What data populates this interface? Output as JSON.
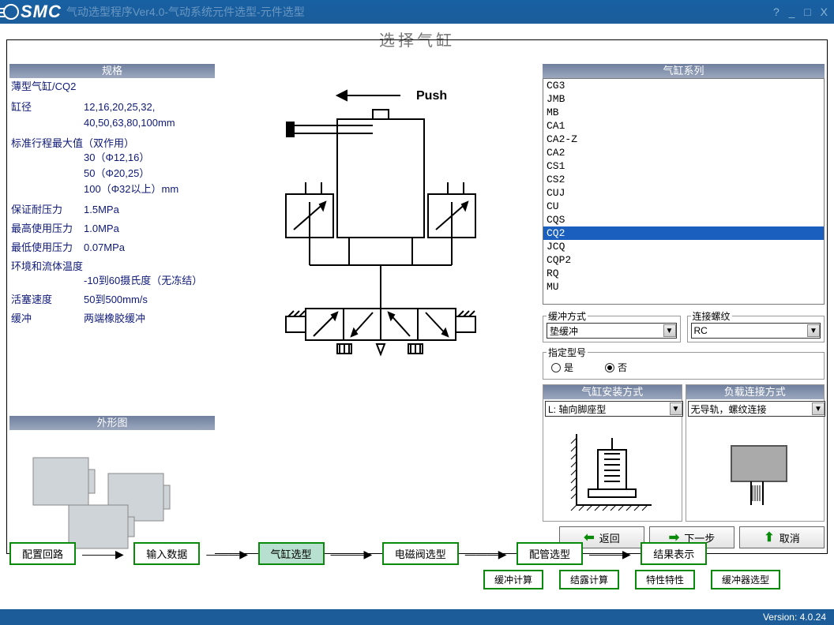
{
  "titlebar": {
    "logo": "SMC",
    "title": "气动选型程序Ver4.0-气动系统元件选型-元件选型",
    "controls": "? _ □ X"
  },
  "page_title": "选择气缸",
  "spec_panel": {
    "title": "规格",
    "model": "薄型气缸/CQ2",
    "rows": {
      "bore_label": "缸径",
      "bore_val1": "12,16,20,25,32,",
      "bore_val2": "40,50,63,80,100mm",
      "stroke_label": "标准行程最大值（双作用）",
      "stroke_val1": "30（Φ12,16）",
      "stroke_val2": "50（Φ20,25）",
      "stroke_val3": "100（Φ32以上）mm",
      "proof_label": "保证耐压力",
      "proof_val": "1.5MPa",
      "max_label": "最高使用压力",
      "max_val": "1.0MPa",
      "min_label": "最低使用压力",
      "min_val": "0.07MPa",
      "temp_label": "环境和流体温度",
      "temp_val": "-10到60摄氏度（无冻结）",
      "speed_label": "活塞速度",
      "speed_val": "50到500mm/s",
      "cushion_label": "缓冲",
      "cushion_val": "两端橡胶缓冲"
    }
  },
  "shape_panel": {
    "title": "外形图"
  },
  "series_panel": {
    "title": "气缸系列",
    "items": [
      "CG3",
      "JMB",
      "MB",
      "CA1",
      "CA2-Z",
      "CA2",
      "CS1",
      "CS2",
      "CUJ",
      "CU",
      "CQS",
      "CQ2",
      "JCQ",
      "CQP2",
      "RQ",
      "MU"
    ],
    "selected": "CQ2"
  },
  "opts": {
    "cushion_label": "缓冲方式",
    "cushion_val": "垫缓冲",
    "thread_label": "连接螺纹",
    "thread_val": "RC",
    "spec_model_label": "指定型号",
    "yes": "是",
    "no": "否"
  },
  "install": {
    "mount_title": "气缸安装方式",
    "mount_val": "L: 轴向脚座型",
    "load_title": "负载连接方式",
    "load_val": "无导轨，螺纹连接"
  },
  "nav": {
    "back": "返回",
    "next": "下一步",
    "cancel": "取消"
  },
  "flow": {
    "b1": "配置回路",
    "b2": "输入数据",
    "b3": "气缸选型",
    "b4": "电磁阀选型",
    "b5": "配管选型",
    "b6": "结果表示",
    "s1": "缓冲计算",
    "s2": "结露计算",
    "s3": "特性特性",
    "s4": "缓冲器选型"
  },
  "diagram": {
    "push": "Push"
  },
  "version": "Version: 4.0.24"
}
